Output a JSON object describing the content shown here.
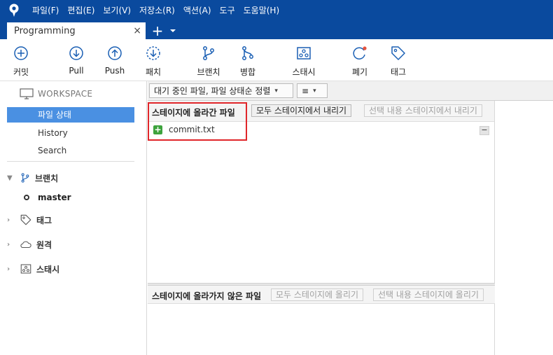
{
  "menu": {
    "items": [
      "파일(F)",
      "편집(E)",
      "보기(V)",
      "저장소(R)",
      "액션(A)",
      "도구",
      "도움말(H)"
    ]
  },
  "tabs": {
    "active_label": "Programming",
    "close_glyph": "×",
    "add_glyph": "+"
  },
  "toolbar": {
    "commit": "커밋",
    "pull": "Pull",
    "push": "Push",
    "fetch": "패치",
    "branch": "브랜치",
    "merge": "병합",
    "stash": "스태시",
    "discard": "폐기",
    "tag": "태그"
  },
  "sidebar": {
    "workspace_header": "WORKSPACE",
    "workspace_items": [
      "파일 상태",
      "History",
      "Search"
    ],
    "selected_item": "파일 상태",
    "groups": {
      "branches": "브랜치",
      "current_branch": "master",
      "tags": "태그",
      "remotes": "원격",
      "stashes": "스태시"
    }
  },
  "filter": {
    "sort_select": "대기 중인 파일, 파일 상태순 정렬",
    "view_select_glyph": "≡"
  },
  "staged": {
    "title": "스테이지에 올라간 파일",
    "unstage_all": "모두 스테이지에서 내리기",
    "unstage_selected": "선택 내용 스테이지에서 내리기",
    "files": [
      "commit.txt"
    ],
    "collapse_glyph": "−"
  },
  "unstaged": {
    "title": "스테이지에 올라가지 않은 파일",
    "stage_all": "모두 스테이지에 올리기",
    "stage_selected": "선택 내용 스테이지에 올리기"
  },
  "colors": {
    "titlebar": "#0a4a9e",
    "selection": "#4a90e2",
    "toolbar_icon": "#1a5fb4",
    "added_icon": "#3da33d",
    "highlight": "#e0262a",
    "discard_dot": "#e5533d"
  },
  "icons": [
    "app-logo-icon",
    "commit-icon",
    "pull-icon",
    "push-icon",
    "fetch-icon",
    "branch-icon",
    "merge-icon",
    "stash-icon",
    "discard-icon",
    "tag-icon",
    "monitor-icon",
    "file-added-icon"
  ]
}
